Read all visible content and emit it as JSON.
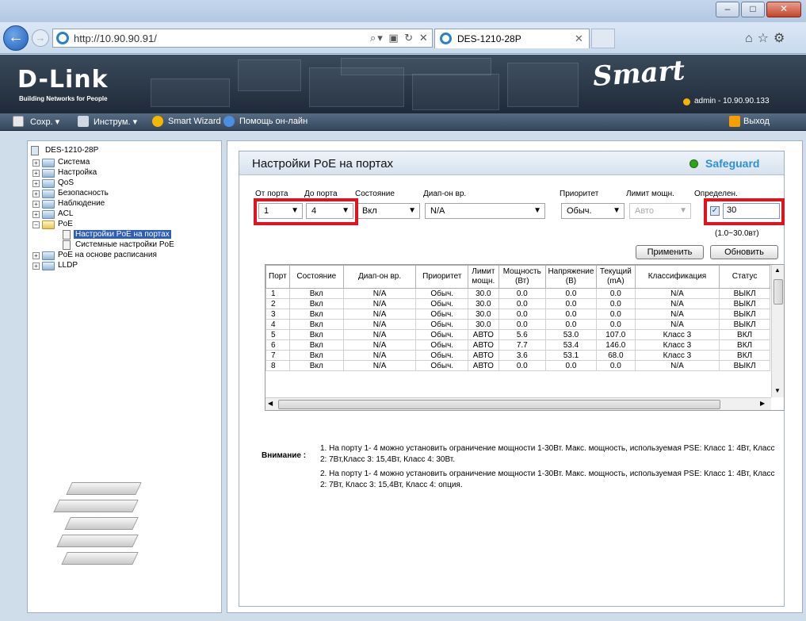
{
  "browser": {
    "url": "http://10.90.90.91/",
    "tab_title": "DES-1210-28P",
    "back_icon": "back-arrow-icon",
    "forward_icon": "forward-arrow-icon"
  },
  "header": {
    "logo": "D-Link",
    "logo_tagline": "Building Networks for People",
    "smart_logo": "Smart",
    "user_info": "admin - 10.90.90.133"
  },
  "toolbar": {
    "save": "Сохр.",
    "tools": "Инструм.",
    "wizard": "Smart Wizard",
    "help": "Помощь он-лайн",
    "logout": "Выход"
  },
  "tree": {
    "root": "DES-1210-28P",
    "items": [
      "Система",
      "Настройка",
      "QoS",
      "Безопасность",
      "Наблюдение",
      "ACL",
      "PoE"
    ],
    "poe_children": [
      "Настройки PoE на портах",
      "Системные настройки PoE"
    ],
    "after": [
      "PoE на основе расписания",
      "LLDP"
    ]
  },
  "main": {
    "title": "Настройки PoE на портах",
    "safeguard": "Safeguard",
    "form": {
      "from_port_label": "От порта",
      "to_port_label": "До порта",
      "state_label": "Состояние",
      "time_range_label": "Диап-он вр.",
      "priority_label": "Приоритет",
      "power_limit_label": "Лимит мощн.",
      "detect_label": "Определен.",
      "from_port": "1",
      "to_port": "4",
      "state": "Вкл",
      "time_range": "N/A",
      "priority": "Обыч.",
      "power_limit": "Авто",
      "detect_value": "30",
      "range_hint": "(1.0~30.0вт)",
      "apply": "Применить",
      "refresh": "Обновить"
    },
    "table": {
      "headers": [
        "Порт",
        "Состояние",
        "Диап-он вр.",
        "Приоритет",
        "Лимит мощн.",
        "Мощность (Вт)",
        "Напряжение (В)",
        "Текущий (mA)",
        "Классификация",
        "Статус"
      ],
      "rows": [
        [
          "1",
          "Вкл",
          "N/A",
          "Обыч.",
          "30.0",
          "0.0",
          "0.0",
          "0.0",
          "N/A",
          "ВЫКЛ"
        ],
        [
          "2",
          "Вкл",
          "N/A",
          "Обыч.",
          "30.0",
          "0.0",
          "0.0",
          "0.0",
          "N/A",
          "ВЫКЛ"
        ],
        [
          "3",
          "Вкл",
          "N/A",
          "Обыч.",
          "30.0",
          "0.0",
          "0.0",
          "0.0",
          "N/A",
          "ВЫКЛ"
        ],
        [
          "4",
          "Вкл",
          "N/A",
          "Обыч.",
          "30.0",
          "0.0",
          "0.0",
          "0.0",
          "N/A",
          "ВЫКЛ"
        ],
        [
          "5",
          "Вкл",
          "N/A",
          "Обыч.",
          "АВТО",
          "5.6",
          "53.0",
          "107.0",
          "Класс 3",
          "ВКЛ"
        ],
        [
          "6",
          "Вкл",
          "N/A",
          "Обыч.",
          "АВТО",
          "7.7",
          "53.4",
          "146.0",
          "Класс 3",
          "ВКЛ"
        ],
        [
          "7",
          "Вкл",
          "N/A",
          "Обыч.",
          "АВТО",
          "3.6",
          "53.1",
          "68.0",
          "Класс 3",
          "ВКЛ"
        ],
        [
          "8",
          "Вкл",
          "N/A",
          "Обыч.",
          "АВТО",
          "0.0",
          "0.0",
          "0.0",
          "N/A",
          "ВЫКЛ"
        ]
      ]
    },
    "note_label": "Внимание :",
    "notes": [
      "1. На порту 1- 4 можно установить ограничение мощности 1-30Вт. Макс. мощность, используемая PSE: Класс 1: 4Вт, Класс 2: 7Вт,Класс 3: 15,4Вт, Класс 4: 30Вт.",
      "2. На порту 1- 4 можно установить ограничение мощности 1-30Вт. Макс. мощность, используемая PSE: Класс 1: 4Вт, Класс 2: 7Вт, Класс 3: 15,4Вт, Класс 4: опция."
    ]
  },
  "colors": {
    "highlight": "#e0141e",
    "header_bg": "#2b3846",
    "selection": "#2d5fb8",
    "safeguard": "#2d8fd6"
  }
}
